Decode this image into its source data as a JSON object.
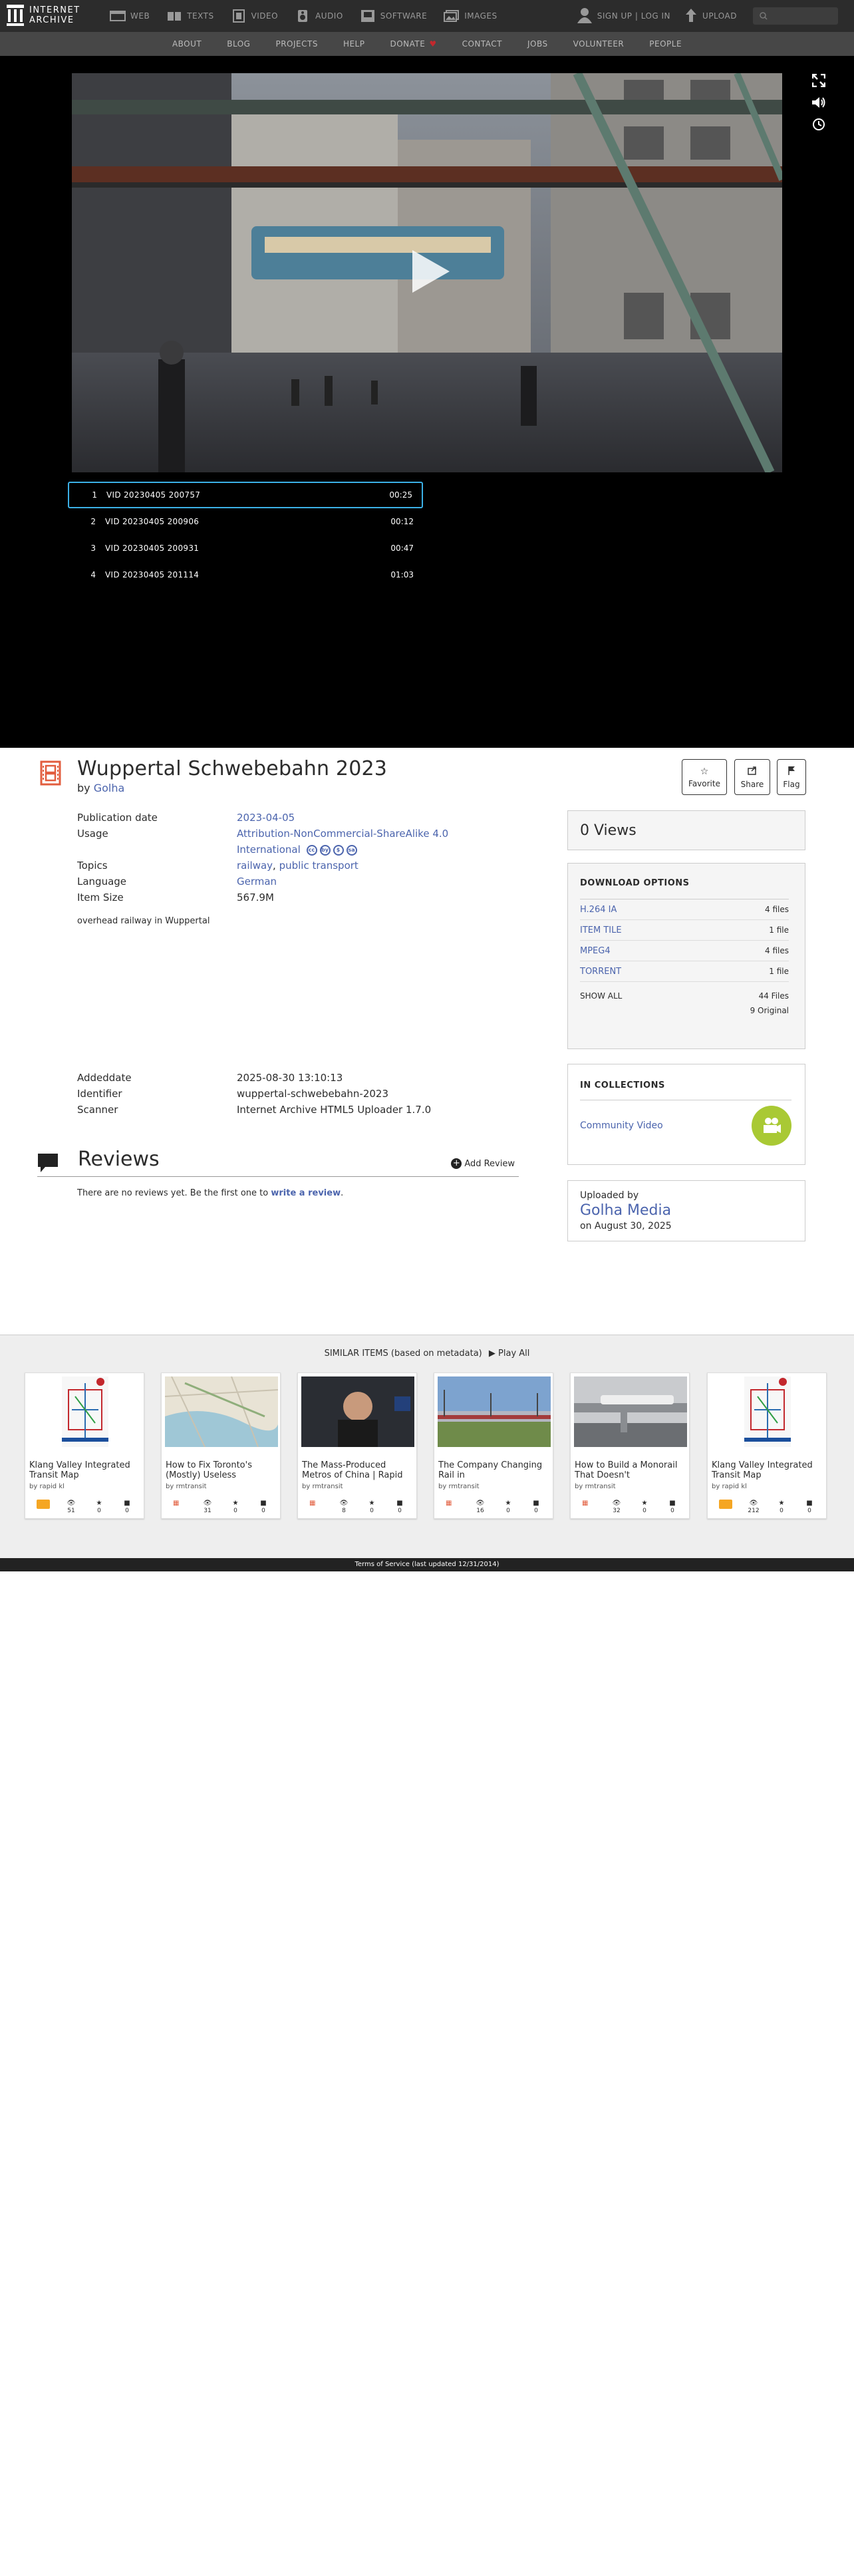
{
  "nav": {
    "logo_line1": "INTERNET",
    "logo_line2": "ARCHIVE",
    "media": [
      {
        "label": "WEB",
        "icon": "web-icon"
      },
      {
        "label": "TEXTS",
        "icon": "texts-icon"
      },
      {
        "label": "VIDEO",
        "icon": "video-icon"
      },
      {
        "label": "AUDIO",
        "icon": "audio-icon"
      },
      {
        "label": "SOFTWARE",
        "icon": "software-icon"
      },
      {
        "label": "IMAGES",
        "icon": "images-icon"
      }
    ],
    "signin": "SIGN UP | LOG IN",
    "upload": "UPLOAD"
  },
  "subnav": [
    "ABOUT",
    "BLOG",
    "PROJECTS",
    "HELP",
    "DONATE",
    "CONTACT",
    "JOBS",
    "VOLUNTEER",
    "PEOPLE"
  ],
  "playlist": [
    {
      "num": "1",
      "title": "VID 20230405 200757",
      "duration": "00:25"
    },
    {
      "num": "2",
      "title": "VID 20230405 200906",
      "duration": "00:12"
    },
    {
      "num": "3",
      "title": "VID 20230405 200931",
      "duration": "00:47"
    },
    {
      "num": "4",
      "title": "VID 20230405 201114",
      "duration": "01:03"
    }
  ],
  "item": {
    "title": "Wuppertal Schwebebahn 2023",
    "by_label": "by",
    "author": "Golha",
    "description": "overhead railway in Wuppertal"
  },
  "actions": {
    "favorite": "Favorite",
    "share": "Share",
    "flag": "Flag"
  },
  "metadata": {
    "pubdate_label": "Publication date",
    "pubdate": "2023-04-05",
    "usage_label": "Usage",
    "usage_line1": "Attribution-NonCommercial-ShareAlike 4.0",
    "usage_line2": "International",
    "topics_label": "Topics",
    "topic1": "railway",
    "topic_sep": ",",
    "topic2": "public transport",
    "language_label": "Language",
    "language": "German",
    "size_label": "Item Size",
    "size": "567.9M",
    "added_label": "Addeddate",
    "added": "2025-08-30 13:10:13",
    "identifier_label": "Identifier",
    "identifier": "wuppertal-schwebebahn-2023",
    "scanner_label": "Scanner",
    "scanner": "Internet Archive HTML5 Uploader 1.7.0"
  },
  "reviews": {
    "title": "Reviews",
    "add": "Add Review",
    "empty_prefix": "There are no reviews yet. Be the first one to",
    "empty_link": "write a review",
    "empty_suffix": "."
  },
  "sidebar": {
    "views": "0 Views",
    "download_title": "DOWNLOAD OPTIONS",
    "downloads": [
      {
        "name": "H.264 IA",
        "count": "4 files"
      },
      {
        "name": "ITEM TILE",
        "count": "1 file"
      },
      {
        "name": "MPEG4",
        "count": "4 files"
      },
      {
        "name": "TORRENT",
        "count": "1 file"
      }
    ],
    "show_all": "SHOW ALL",
    "total_files": "44 Files",
    "original": "9 Original",
    "collections_title": "IN COLLECTIONS",
    "collection": "Community Video",
    "uploaded_by": "Uploaded by",
    "uploader": "Golha Media",
    "upload_date": "on August 30, 2025"
  },
  "similar": {
    "heading": "SIMILAR ITEMS (based on metadata)",
    "play_all": "Play All",
    "cards": [
      {
        "title": "Klang Valley Integrated Transit Map",
        "by": "by rapid kl",
        "views": "51",
        "favs": "0",
        "reviews": "0",
        "type": "texts"
      },
      {
        "title": "How to Fix Toronto's (Mostly) Useless",
        "by": "by rmtransit",
        "views": "31",
        "favs": "0",
        "reviews": "0",
        "type": "movies"
      },
      {
        "title": "The Mass-Produced Metros of China | Rapid",
        "by": "by rmtransit",
        "views": "8",
        "favs": "0",
        "reviews": "0",
        "type": "movies"
      },
      {
        "title": "The Company Changing Rail in",
        "by": "by rmtransit",
        "views": "16",
        "favs": "0",
        "reviews": "0",
        "type": "movies"
      },
      {
        "title": "How to Build a Monorail That Doesn't",
        "by": "by rmtransit",
        "views": "32",
        "favs": "0",
        "reviews": "0",
        "type": "movies"
      },
      {
        "title": "Klang Valley Integrated Transit Map",
        "by": "by rapid kl",
        "views": "212",
        "favs": "0",
        "reviews": "0",
        "type": "texts"
      }
    ]
  },
  "footer": "Terms of Service (last updated 12/31/2014)",
  "colors": {
    "link": "#4b64ad",
    "accent": "#3bb0e6",
    "movie": "#e25d3e",
    "texts": "#f5a623"
  }
}
